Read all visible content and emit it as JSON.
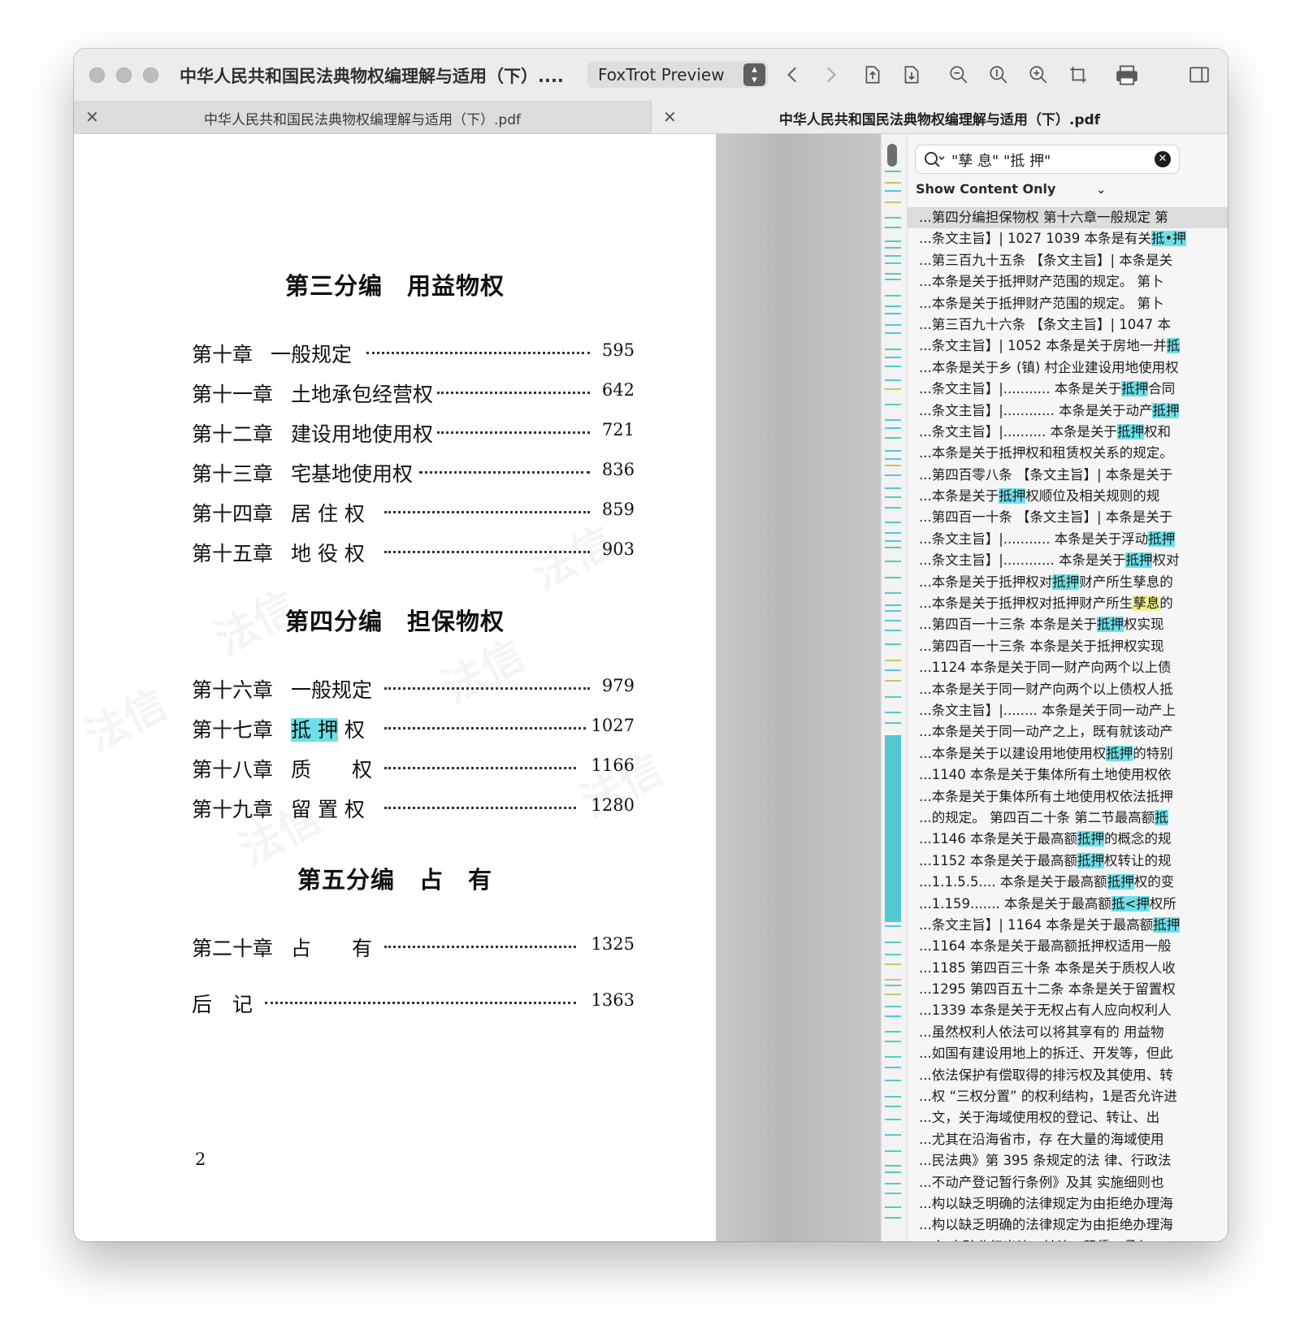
{
  "window": {
    "title": "中华人民共和国民法典物权编理解与适用（下）....",
    "app_selector": "FoxTrot Preview"
  },
  "tabs": [
    {
      "label": "中华人民共和国民法典物权编理解与适用（下）.pdf"
    },
    {
      "label": "中华人民共和国民法典物权编理解与适用（下）.pdf"
    }
  ],
  "page": {
    "watermark": "法信",
    "part3": {
      "heading": "第三分编　用益物权"
    },
    "part4": {
      "heading": "第四分编　担保物权"
    },
    "part5": {
      "heading": "第五分编　占　有"
    },
    "toc": [
      {
        "chapter": "第十章",
        "title": "一般规定",
        "page": "595"
      },
      {
        "chapter": "第十一章",
        "title": "土地承包经营权",
        "page": "642"
      },
      {
        "chapter": "第十二章",
        "title": "建设用地使用权",
        "page": "721"
      },
      {
        "chapter": "第十三章",
        "title": "宅基地使用权",
        "page": "836"
      },
      {
        "chapter": "第十四章",
        "title": "居 住 权",
        "page": "859"
      },
      {
        "chapter": "第十五章",
        "title": "地 役 权",
        "page": "903"
      },
      {
        "chapter": "第十六章",
        "title": "一般规定",
        "page": "979"
      },
      {
        "chapter": "第十七章",
        "title_hl": "抵 押",
        "title_rest": " 权",
        "page": "1027"
      },
      {
        "chapter": "第十八章",
        "title": "质　　权",
        "page": "1166"
      },
      {
        "chapter": "第十九章",
        "title": "留 置 权",
        "page": "1280"
      },
      {
        "chapter": "第二十章",
        "title": "占　　有",
        "page": "1325"
      },
      {
        "chapter": "后　记",
        "title": "",
        "page": "1363"
      }
    ],
    "page_number": "2"
  },
  "search": {
    "query": "\"孳 息\" \"抵 押\"",
    "filter_label": "Show Content Only"
  },
  "results": [
    {
      "pre": "...第四分编担保物权 第十六章一般规定 第",
      "hl": "",
      "post": "",
      "color": "cyan"
    },
    {
      "pre": "...条文主旨】| 1027 1039 本条是有关",
      "hl": "抵•押",
      "post": "",
      "color": "cyan"
    },
    {
      "pre": "...第三百九十五条 【条文主旨】| 本条是关",
      "hl": "",
      "post": "",
      "color": "cyan"
    },
    {
      "pre": "...本条是关于抵押财产范围的规定。 第卜",
      "hl": "",
      "post": "",
      "color": "cyan"
    },
    {
      "pre": "...本条是关于抵押财产范围的规定。 第卜",
      "hl": "",
      "post": "",
      "color": "cyan"
    },
    {
      "pre": "...第三百九十六条 【条文主旨】| 1047 本",
      "hl": "",
      "post": "",
      "color": "cyan"
    },
    {
      "pre": "...条文主旨】| 1052 本条是关于房地一并",
      "hl": "抵",
      "post": "",
      "color": "cyan"
    },
    {
      "pre": "...本条是关于乡 (镇) 村企业建设用地使用权",
      "hl": "",
      "post": "",
      "color": "cyan"
    },
    {
      "pre": "...条文主旨】|........... 本条是关于",
      "hl": "抵押",
      "post": "合同",
      "color": "cyan"
    },
    {
      "pre": "...条文主旨】|............ 本条是关于动产",
      "hl": "抵押",
      "post": "",
      "color": "cyan"
    },
    {
      "pre": "...条文主旨】|.......... 本条是关于",
      "hl": "抵押",
      "post": "权和",
      "color": "cyan"
    },
    {
      "pre": "...本条是关于抵押权和租赁权关系的规定。",
      "hl": "",
      "post": "",
      "color": "cyan"
    },
    {
      "pre": "...第四百零八条 【条文主旨】| 本条是关于",
      "hl": "",
      "post": "",
      "color": "cyan"
    },
    {
      "pre": "...本条是关于",
      "hl": "抵押",
      "post": "权顺位及相关规则的规",
      "color": "cyan"
    },
    {
      "pre": "...第四百一十条 【条文主旨】| 本条是关于",
      "hl": "",
      "post": "",
      "color": "cyan"
    },
    {
      "pre": "...条文主旨】|........... 本条是关于浮动",
      "hl": "抵押",
      "post": "",
      "color": "cyan"
    },
    {
      "pre": "...条文主旨】|............ 本条是关于",
      "hl": "抵押",
      "post": "权对",
      "color": "cyan"
    },
    {
      "pre": "...本条是关于抵押权对",
      "hl": "抵押",
      "post": "财产所生孳息的",
      "color": "cyan"
    },
    {
      "pre": "...本条是关于抵押权对抵押财产所生",
      "hl": "孳息",
      "post": "的",
      "color": "yellow"
    },
    {
      "pre": "...第四百一十三条 本条是关于",
      "hl": "抵押",
      "post": "权实现",
      "color": "cyan"
    },
    {
      "pre": "...第四百一十三条 本条是关于抵押权实现",
      "hl": "",
      "post": "",
      "color": "cyan"
    },
    {
      "pre": "...1124 本条是关于同一财产向两个以上债",
      "hl": "",
      "post": "",
      "color": "cyan"
    },
    {
      "pre": "...本条是关于同一财产向两个以上债权人抵",
      "hl": "",
      "post": "",
      "color": "cyan"
    },
    {
      "pre": "...条文主旨】|........ 本条是关于同一动产上",
      "hl": "",
      "post": "",
      "color": "cyan"
    },
    {
      "pre": "...本条是关于同一动产之上，既有就该动产",
      "hl": "",
      "post": "",
      "color": "cyan"
    },
    {
      "pre": "...本条是关于以建设用地使用权",
      "hl": "抵押",
      "post": "的特别",
      "color": "cyan"
    },
    {
      "pre": "...1140 本条是关于集体所有土地使用权依",
      "hl": "",
      "post": "",
      "color": "cyan"
    },
    {
      "pre": "...本条是关于集体所有土地使用权依法抵押",
      "hl": "",
      "post": "",
      "color": "cyan"
    },
    {
      "pre": "...的规定。 第四百二十条 第二节最高额",
      "hl": "抵",
      "post": "",
      "color": "cyan"
    },
    {
      "pre": "...1146 本条是关于最高额",
      "hl": "抵押",
      "post": "的概念的规",
      "color": "cyan"
    },
    {
      "pre": "...1152 本条是关于最高额",
      "hl": "抵押",
      "post": "权转让的规",
      "color": "cyan"
    },
    {
      "pre": "...1.1.5.5.... 本条是关于最高额",
      "hl": "抵押",
      "post": "权的变",
      "color": "cyan"
    },
    {
      "pre": "...1.159....... 本条是关于最高额",
      "hl": "抵<押",
      "post": "权所",
      "color": "cyan"
    },
    {
      "pre": "...条文主旨】| 1164 本条是关于最高额",
      "hl": "抵押",
      "post": "",
      "color": "cyan"
    },
    {
      "pre": "...1164 本条是关于最高额抵押权适用一般",
      "hl": "",
      "post": "",
      "color": "cyan"
    },
    {
      "pre": "...1185 第四百三十条 本条是关于质权人收",
      "hl": "",
      "post": "",
      "color": "cyan"
    },
    {
      "pre": "...1295 第四百五十二条 本条是关于留置权",
      "hl": "",
      "post": "",
      "color": "cyan"
    },
    {
      "pre": "...1339 本条是关于无权占有人应向权利人",
      "hl": "",
      "post": "",
      "color": "cyan"
    },
    {
      "pre": "...虽然权利人依法可以将其享有的 用益物",
      "hl": "",
      "post": "",
      "color": "cyan"
    },
    {
      "pre": "...如国有建设用地上的拆迁、开发等，但此",
      "hl": "",
      "post": "",
      "color": "cyan"
    },
    {
      "pre": "...依法保护有偿取得的排污权及其使用、转",
      "hl": "",
      "post": "",
      "color": "cyan"
    },
    {
      "pre": "...权 “三权分置” 的权利结构，1是否允许进",
      "hl": "",
      "post": "",
      "color": "cyan"
    },
    {
      "pre": "...文，关于海域使用权的登记、转让、出",
      "hl": "",
      "post": "",
      "color": "cyan"
    },
    {
      "pre": "...尤其在沿海省市，存 在大量的海域使用",
      "hl": "",
      "post": "",
      "color": "cyan"
    },
    {
      "pre": "...民法典》第 395 条规定的法 律、行政法",
      "hl": "",
      "post": "",
      "color": "cyan"
    },
    {
      "pre": "...不动产登记暂行条例》及其 实施细则也",
      "hl": "",
      "post": "",
      "color": "cyan"
    },
    {
      "pre": "...构以缺乏明确的法律规定为由拒绝办理海",
      "hl": "",
      "post": "",
      "color": "cyan"
    },
    {
      "pre": "...构以缺乏明确的法律规定为由拒绝办理海",
      "hl": "",
      "post": "",
      "color": "cyan"
    },
    {
      "pre": "...中对 矿业权出让、转让、租赁、承包、",
      "hl": "",
      "post": "",
      "color": "cyan"
    }
  ],
  "scroll_markers": {
    "cyan": "#53c9cf",
    "yellow": "#c8c56a"
  }
}
